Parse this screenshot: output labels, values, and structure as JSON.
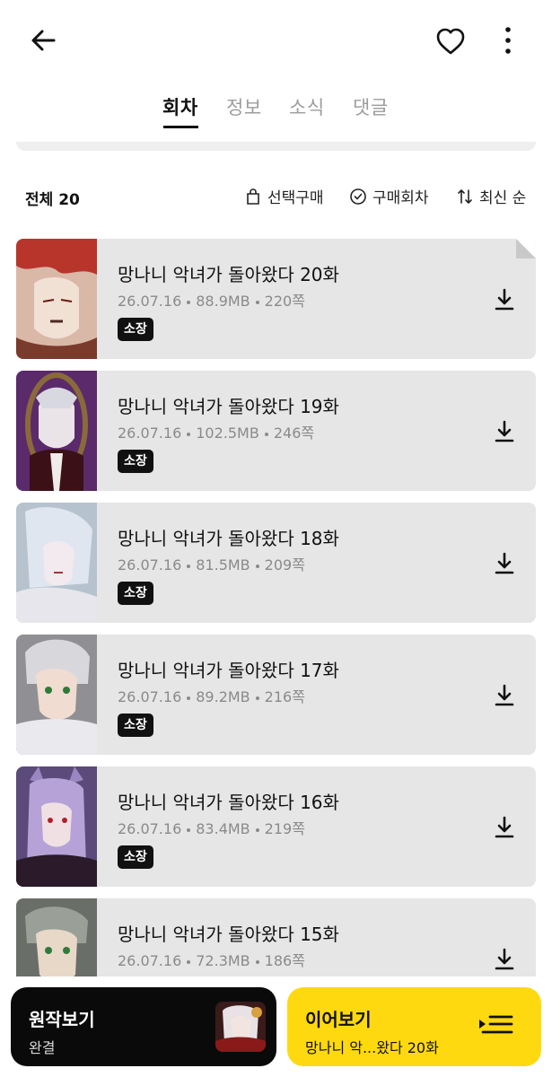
{
  "header": {
    "back_icon": "arrow-left-icon",
    "favorite_icon": "heart-icon",
    "more_icon": "more-vertical-icon"
  },
  "tabs": [
    {
      "label": "회차",
      "active": true
    },
    {
      "label": "정보",
      "active": false
    },
    {
      "label": "소식",
      "active": false
    },
    {
      "label": "댓글",
      "active": false
    }
  ],
  "filter": {
    "total_label": "전체 20",
    "select_purchase": "선택구매",
    "purchased": "구매회차",
    "sort": "최신 순"
  },
  "episodes": [
    {
      "title": "망나니 악녀가 돌아왔다 20화",
      "date": "26.07.16",
      "size": "88.9MB",
      "pages": "220쪽",
      "badge": "소장"
    },
    {
      "title": "망나니 악녀가 돌아왔다 19화",
      "date": "26.07.16",
      "size": "102.5MB",
      "pages": "246쪽",
      "badge": "소장"
    },
    {
      "title": "망나니 악녀가 돌아왔다 18화",
      "date": "26.07.16",
      "size": "81.5MB",
      "pages": "209쪽",
      "badge": "소장"
    },
    {
      "title": "망나니 악녀가 돌아왔다 17화",
      "date": "26.07.16",
      "size": "89.2MB",
      "pages": "216쪽",
      "badge": "소장"
    },
    {
      "title": "망나니 악녀가 돌아왔다 16화",
      "date": "26.07.16",
      "size": "83.4MB",
      "pages": "219쪽",
      "badge": "소장"
    },
    {
      "title": "망나니 악녀가 돌아왔다 15화",
      "date": "26.07.16",
      "size": "72.3MB",
      "pages": "186쪽",
      "badge": ""
    }
  ],
  "bottom": {
    "original": {
      "title": "원작보기",
      "subtitle": "완결"
    },
    "continue": {
      "title": "이어보기",
      "subtitle": "망나니 악...왔다 20화"
    }
  },
  "colors": {
    "accent_yellow": "#ffd910",
    "card_bg": "#e6e6e6",
    "meta_gray": "#8a8a8a"
  }
}
